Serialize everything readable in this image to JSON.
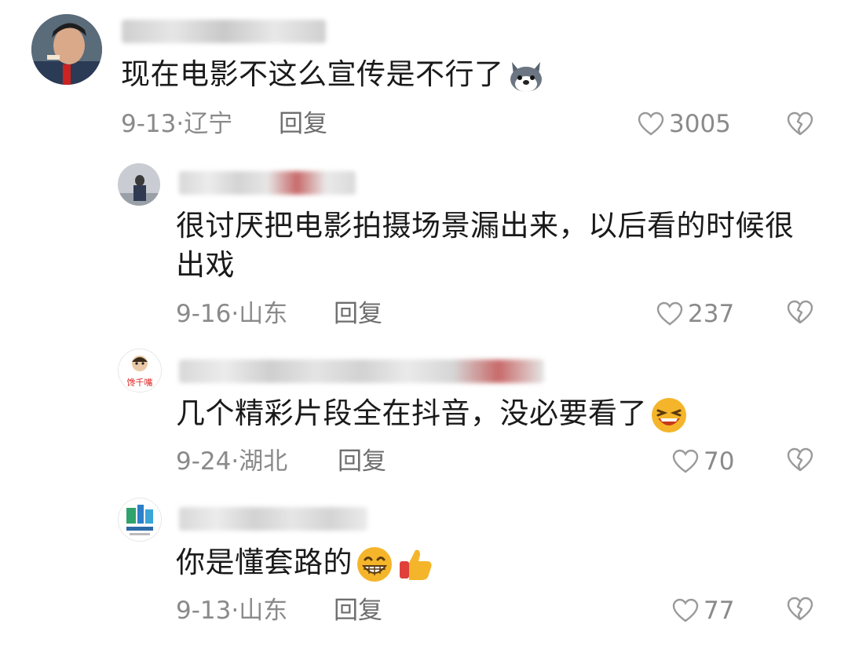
{
  "comments": [
    {
      "text": "现在电影不这么宣传是不行了",
      "emoji": [
        "husky-emoji"
      ],
      "date": "9-13",
      "region": "辽宁",
      "reply_label": "回复",
      "likes": "3005"
    },
    {
      "text_line1": "很讨厌把电影拍摄场景漏出来，以后看的时候很",
      "text_line2": "出戏",
      "date": "9-16",
      "region": "山东",
      "reply_label": "回复",
      "likes": "237"
    },
    {
      "text": "几个精彩片段全在抖音，没必要看了",
      "emoji": [
        "laughing-emoji"
      ],
      "date": "9-24",
      "region": "湖北",
      "reply_label": "回复",
      "likes": "70",
      "avatar_text": "馋千嘴"
    },
    {
      "text": "你是懂套路的",
      "emoji": [
        "grin-emoji",
        "thumbs-up-emoji"
      ],
      "date": "9-13",
      "region": "山东",
      "reply_label": "回复",
      "likes": "77"
    }
  ],
  "separator": "·",
  "colors": {
    "text": "#1a1a1a",
    "meta": "#8a8a8a",
    "icon": "#9a9a9a"
  }
}
